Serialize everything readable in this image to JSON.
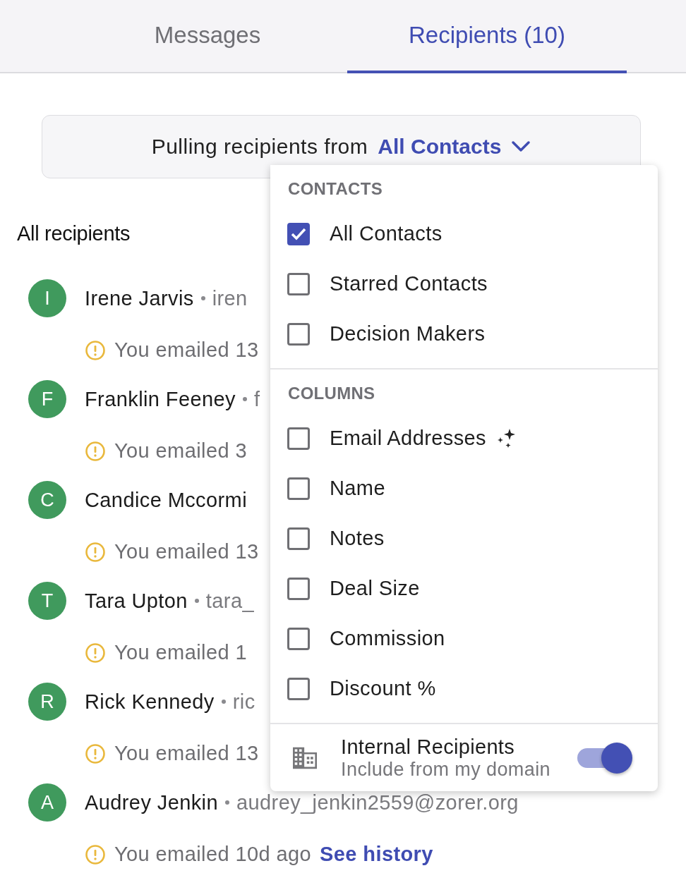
{
  "tabs": [
    {
      "label": "Messages",
      "selected": false
    },
    {
      "label": "Recipients (10)",
      "selected": true
    }
  ],
  "source": {
    "prefix": "Pulling recipients from",
    "value": "All Contacts"
  },
  "list_title": "All recipients",
  "recipients": [
    {
      "initial": "I",
      "name": "Irene Jarvis",
      "email": "iren",
      "activity": "You emailed 13"
    },
    {
      "initial": "F",
      "name": "Franklin Feeney",
      "email": "f",
      "activity": "You emailed 3"
    },
    {
      "initial": "C",
      "name": "Candice Mccormi",
      "activity": "You emailed 13"
    },
    {
      "initial": "T",
      "name": "Tara Upton",
      "email": "tara_",
      "activity": "You emailed 1"
    },
    {
      "initial": "R",
      "name": "Rick Kennedy",
      "email": "ric",
      "activity": "You emailed 13"
    },
    {
      "initial": "A",
      "name": "Audrey Jenkin",
      "email": "audrey_jenkin2559@zorer.org",
      "activity": "You emailed 10d ago",
      "link": "See history"
    }
  ],
  "menu": {
    "contacts_heading": "CONTACTS",
    "contacts": [
      {
        "label": "All Contacts",
        "checked": true
      },
      {
        "label": "Starred Contacts",
        "checked": false
      },
      {
        "label": "Decision Makers",
        "checked": false
      }
    ],
    "columns_heading": "COLUMNS",
    "columns": [
      {
        "label": "Email Addresses",
        "checked": false,
        "kind": "sparkle"
      },
      {
        "label": "Name",
        "checked": false,
        "kind": "plain"
      },
      {
        "label": "Notes",
        "checked": false,
        "kind": "plain"
      },
      {
        "label": "Deal Size",
        "checked": false,
        "kind": "plain"
      },
      {
        "label": "Commission",
        "checked": false,
        "kind": "plain"
      },
      {
        "label": "Discount %",
        "checked": false,
        "kind": "plain"
      }
    ],
    "internal": {
      "title": "Internal Recipients",
      "subtitle": "Include from my domain",
      "on": true
    }
  }
}
